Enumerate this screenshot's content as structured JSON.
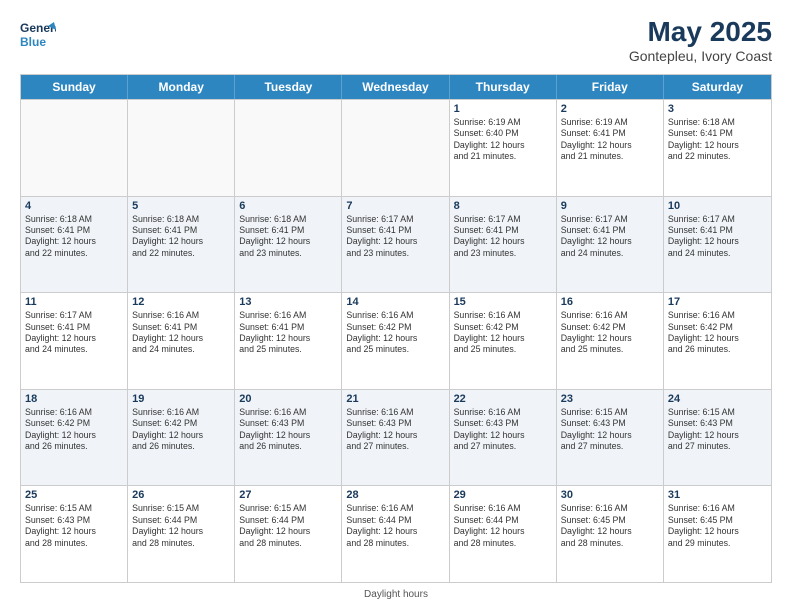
{
  "header": {
    "logo_line1": "General",
    "logo_line2": "Blue",
    "month_year": "May 2025",
    "location": "Gontepleu, Ivory Coast"
  },
  "days_of_week": [
    "Sunday",
    "Monday",
    "Tuesday",
    "Wednesday",
    "Thursday",
    "Friday",
    "Saturday"
  ],
  "footer": {
    "note": "Daylight hours"
  },
  "weeks": [
    [
      {
        "day": "",
        "info": "",
        "empty": true
      },
      {
        "day": "",
        "info": "",
        "empty": true
      },
      {
        "day": "",
        "info": "",
        "empty": true
      },
      {
        "day": "",
        "info": "",
        "empty": true
      },
      {
        "day": "1",
        "info": "Sunrise: 6:19 AM\nSunset: 6:40 PM\nDaylight: 12 hours\nand 21 minutes.",
        "empty": false
      },
      {
        "day": "2",
        "info": "Sunrise: 6:19 AM\nSunset: 6:41 PM\nDaylight: 12 hours\nand 21 minutes.",
        "empty": false
      },
      {
        "day": "3",
        "info": "Sunrise: 6:18 AM\nSunset: 6:41 PM\nDaylight: 12 hours\nand 22 minutes.",
        "empty": false
      }
    ],
    [
      {
        "day": "4",
        "info": "Sunrise: 6:18 AM\nSunset: 6:41 PM\nDaylight: 12 hours\nand 22 minutes.",
        "empty": false
      },
      {
        "day": "5",
        "info": "Sunrise: 6:18 AM\nSunset: 6:41 PM\nDaylight: 12 hours\nand 22 minutes.",
        "empty": false
      },
      {
        "day": "6",
        "info": "Sunrise: 6:18 AM\nSunset: 6:41 PM\nDaylight: 12 hours\nand 23 minutes.",
        "empty": false
      },
      {
        "day": "7",
        "info": "Sunrise: 6:17 AM\nSunset: 6:41 PM\nDaylight: 12 hours\nand 23 minutes.",
        "empty": false
      },
      {
        "day": "8",
        "info": "Sunrise: 6:17 AM\nSunset: 6:41 PM\nDaylight: 12 hours\nand 23 minutes.",
        "empty": false
      },
      {
        "day": "9",
        "info": "Sunrise: 6:17 AM\nSunset: 6:41 PM\nDaylight: 12 hours\nand 24 minutes.",
        "empty": false
      },
      {
        "day": "10",
        "info": "Sunrise: 6:17 AM\nSunset: 6:41 PM\nDaylight: 12 hours\nand 24 minutes.",
        "empty": false
      }
    ],
    [
      {
        "day": "11",
        "info": "Sunrise: 6:17 AM\nSunset: 6:41 PM\nDaylight: 12 hours\nand 24 minutes.",
        "empty": false
      },
      {
        "day": "12",
        "info": "Sunrise: 6:16 AM\nSunset: 6:41 PM\nDaylight: 12 hours\nand 24 minutes.",
        "empty": false
      },
      {
        "day": "13",
        "info": "Sunrise: 6:16 AM\nSunset: 6:41 PM\nDaylight: 12 hours\nand 25 minutes.",
        "empty": false
      },
      {
        "day": "14",
        "info": "Sunrise: 6:16 AM\nSunset: 6:42 PM\nDaylight: 12 hours\nand 25 minutes.",
        "empty": false
      },
      {
        "day": "15",
        "info": "Sunrise: 6:16 AM\nSunset: 6:42 PM\nDaylight: 12 hours\nand 25 minutes.",
        "empty": false
      },
      {
        "day": "16",
        "info": "Sunrise: 6:16 AM\nSunset: 6:42 PM\nDaylight: 12 hours\nand 25 minutes.",
        "empty": false
      },
      {
        "day": "17",
        "info": "Sunrise: 6:16 AM\nSunset: 6:42 PM\nDaylight: 12 hours\nand 26 minutes.",
        "empty": false
      }
    ],
    [
      {
        "day": "18",
        "info": "Sunrise: 6:16 AM\nSunset: 6:42 PM\nDaylight: 12 hours\nand 26 minutes.",
        "empty": false
      },
      {
        "day": "19",
        "info": "Sunrise: 6:16 AM\nSunset: 6:42 PM\nDaylight: 12 hours\nand 26 minutes.",
        "empty": false
      },
      {
        "day": "20",
        "info": "Sunrise: 6:16 AM\nSunset: 6:43 PM\nDaylight: 12 hours\nand 26 minutes.",
        "empty": false
      },
      {
        "day": "21",
        "info": "Sunrise: 6:16 AM\nSunset: 6:43 PM\nDaylight: 12 hours\nand 27 minutes.",
        "empty": false
      },
      {
        "day": "22",
        "info": "Sunrise: 6:16 AM\nSunset: 6:43 PM\nDaylight: 12 hours\nand 27 minutes.",
        "empty": false
      },
      {
        "day": "23",
        "info": "Sunrise: 6:15 AM\nSunset: 6:43 PM\nDaylight: 12 hours\nand 27 minutes.",
        "empty": false
      },
      {
        "day": "24",
        "info": "Sunrise: 6:15 AM\nSunset: 6:43 PM\nDaylight: 12 hours\nand 27 minutes.",
        "empty": false
      }
    ],
    [
      {
        "day": "25",
        "info": "Sunrise: 6:15 AM\nSunset: 6:43 PM\nDaylight: 12 hours\nand 28 minutes.",
        "empty": false
      },
      {
        "day": "26",
        "info": "Sunrise: 6:15 AM\nSunset: 6:44 PM\nDaylight: 12 hours\nand 28 minutes.",
        "empty": false
      },
      {
        "day": "27",
        "info": "Sunrise: 6:15 AM\nSunset: 6:44 PM\nDaylight: 12 hours\nand 28 minutes.",
        "empty": false
      },
      {
        "day": "28",
        "info": "Sunrise: 6:16 AM\nSunset: 6:44 PM\nDaylight: 12 hours\nand 28 minutes.",
        "empty": false
      },
      {
        "day": "29",
        "info": "Sunrise: 6:16 AM\nSunset: 6:44 PM\nDaylight: 12 hours\nand 28 minutes.",
        "empty": false
      },
      {
        "day": "30",
        "info": "Sunrise: 6:16 AM\nSunset: 6:45 PM\nDaylight: 12 hours\nand 28 minutes.",
        "empty": false
      },
      {
        "day": "31",
        "info": "Sunrise: 6:16 AM\nSunset: 6:45 PM\nDaylight: 12 hours\nand 29 minutes.",
        "empty": false
      }
    ]
  ]
}
